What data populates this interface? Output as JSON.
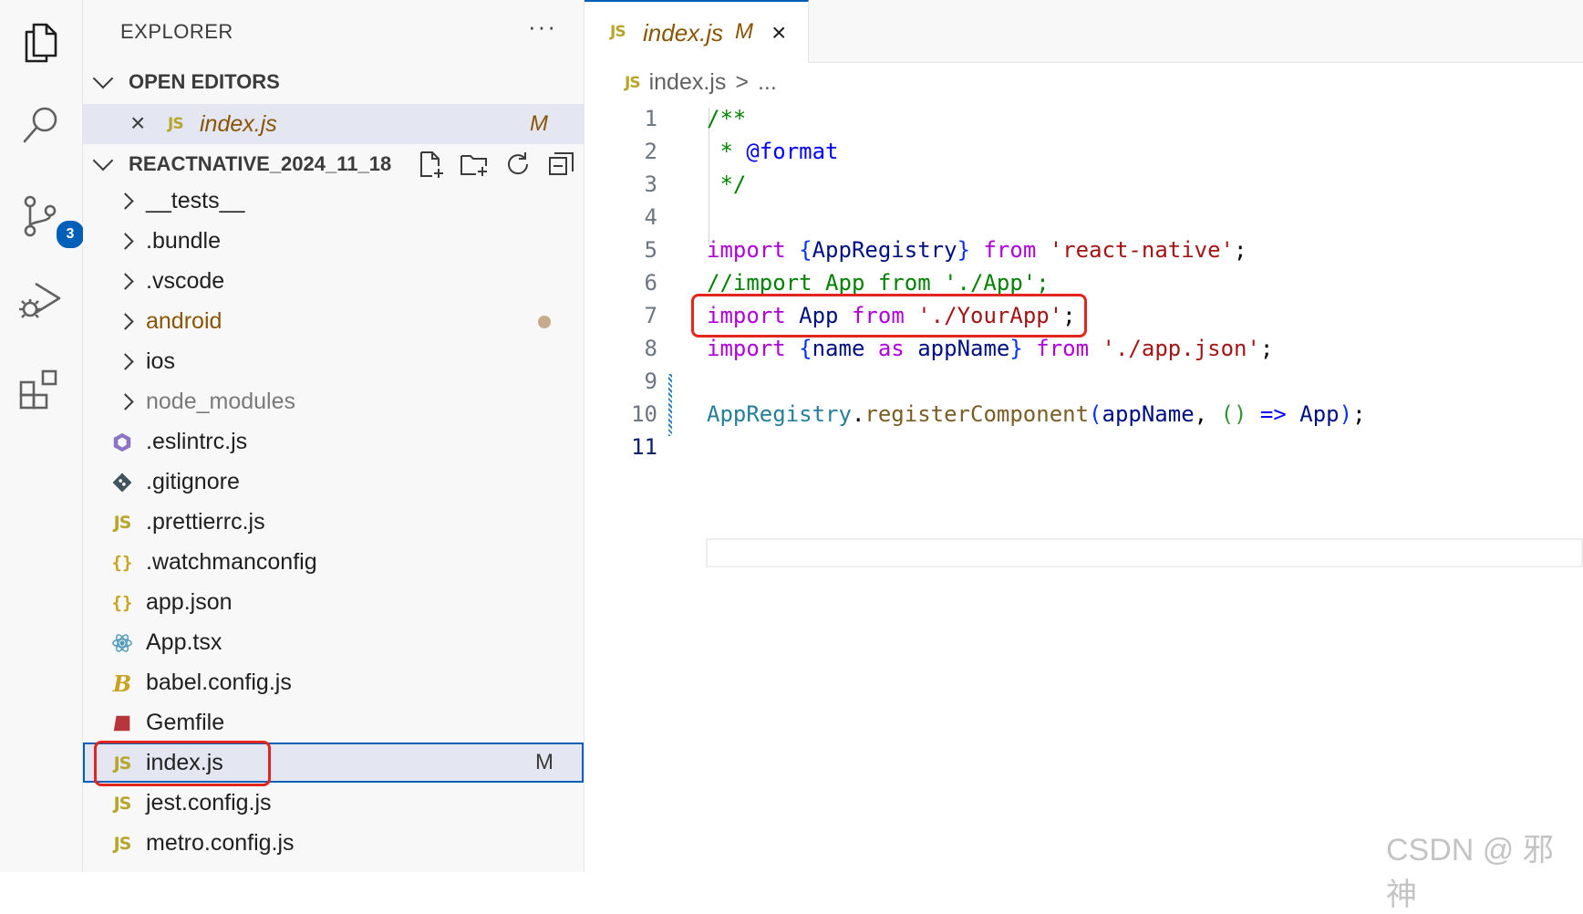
{
  "activity_bar": {
    "items": [
      "explorer-icon",
      "search-icon",
      "source-control-icon",
      "run-debug-icon",
      "extensions-icon"
    ],
    "source_control_badge": "3"
  },
  "explorer": {
    "title": "EXPLORER",
    "more": "···",
    "open_editors": {
      "header": "OPEN EDITORS",
      "files": [
        {
          "name": "index.js",
          "status": "M"
        }
      ]
    },
    "project": {
      "header": "REACTNATIVE_2024_11_18",
      "folders": [
        {
          "name": "__tests__"
        },
        {
          "name": ".bundle"
        },
        {
          "name": ".vscode"
        },
        {
          "name": "android"
        },
        {
          "name": "ios"
        },
        {
          "name": "node_modules"
        }
      ],
      "files": [
        {
          "name": ".eslintrc.js",
          "icon": "eslint-icon"
        },
        {
          "name": ".gitignore",
          "icon": "git-icon"
        },
        {
          "name": ".prettierrc.js",
          "icon": "js-icon"
        },
        {
          "name": ".watchmanconfig",
          "icon": "json-icon"
        },
        {
          "name": "app.json",
          "icon": "json-icon"
        },
        {
          "name": "App.tsx",
          "icon": "react-icon"
        },
        {
          "name": "babel.config.js",
          "icon": "babel-icon"
        },
        {
          "name": "Gemfile",
          "icon": "ruby-icon"
        },
        {
          "name": "index.js",
          "icon": "js-icon",
          "status": "M"
        },
        {
          "name": "jest.config.js",
          "icon": "js-icon"
        },
        {
          "name": "metro.config.js",
          "icon": "js-icon"
        }
      ]
    }
  },
  "editor": {
    "tab": {
      "name": "index.js",
      "status": "M",
      "close": "×",
      "file_type": "JS"
    },
    "breadcrumb": {
      "file": "index.js",
      "separator": ">",
      "rest": "..."
    },
    "lines": {
      "1": "1",
      "2": "2",
      "3": "3",
      "4": "4",
      "5": "5",
      "6": "6",
      "7": "7",
      "8": "8",
      "9": "9",
      "10": "10",
      "11": "11"
    },
    "code": {
      "l1": "/**",
      "l2_star": " * ",
      "l2_tag": "@format",
      "l3": " */",
      "l5_kw": "import",
      "l5_ob": "{",
      "l5_id": "AppRegistry",
      "l5_cb": "}",
      "l5_from": "from",
      "l5_str": "'react-native'",
      "l5_semi": ";",
      "l6": "//import App from './App';",
      "l7_kw": "import",
      "l7_id": "App",
      "l7_from": "from",
      "l7_str": "'./YourApp'",
      "l7_semi": ";",
      "l8_kw": "import",
      "l8_ob": "{",
      "l8_id1": "name",
      "l8_as": "as",
      "l8_id2": "appName",
      "l8_cb": "}",
      "l8_from": "from",
      "l8_str": "'./app.json'",
      "l8_semi": ";",
      "l10_type": "AppRegistry",
      "l10_dot": ".",
      "l10_fn": "registerComponent",
      "l10_op": "(",
      "l10_arg": "appName",
      "l10_comma": ", ",
      "l10_paren": "()",
      "l10_arrow": "=>",
      "l10_app": "App",
      "l10_cp": ")",
      "l10_semi": ";"
    }
  },
  "watermark": "CSDN @ 邪神",
  "colors": {
    "accent": "#005fb8",
    "highlight_box": "#e3261d",
    "modified": "#895503"
  }
}
